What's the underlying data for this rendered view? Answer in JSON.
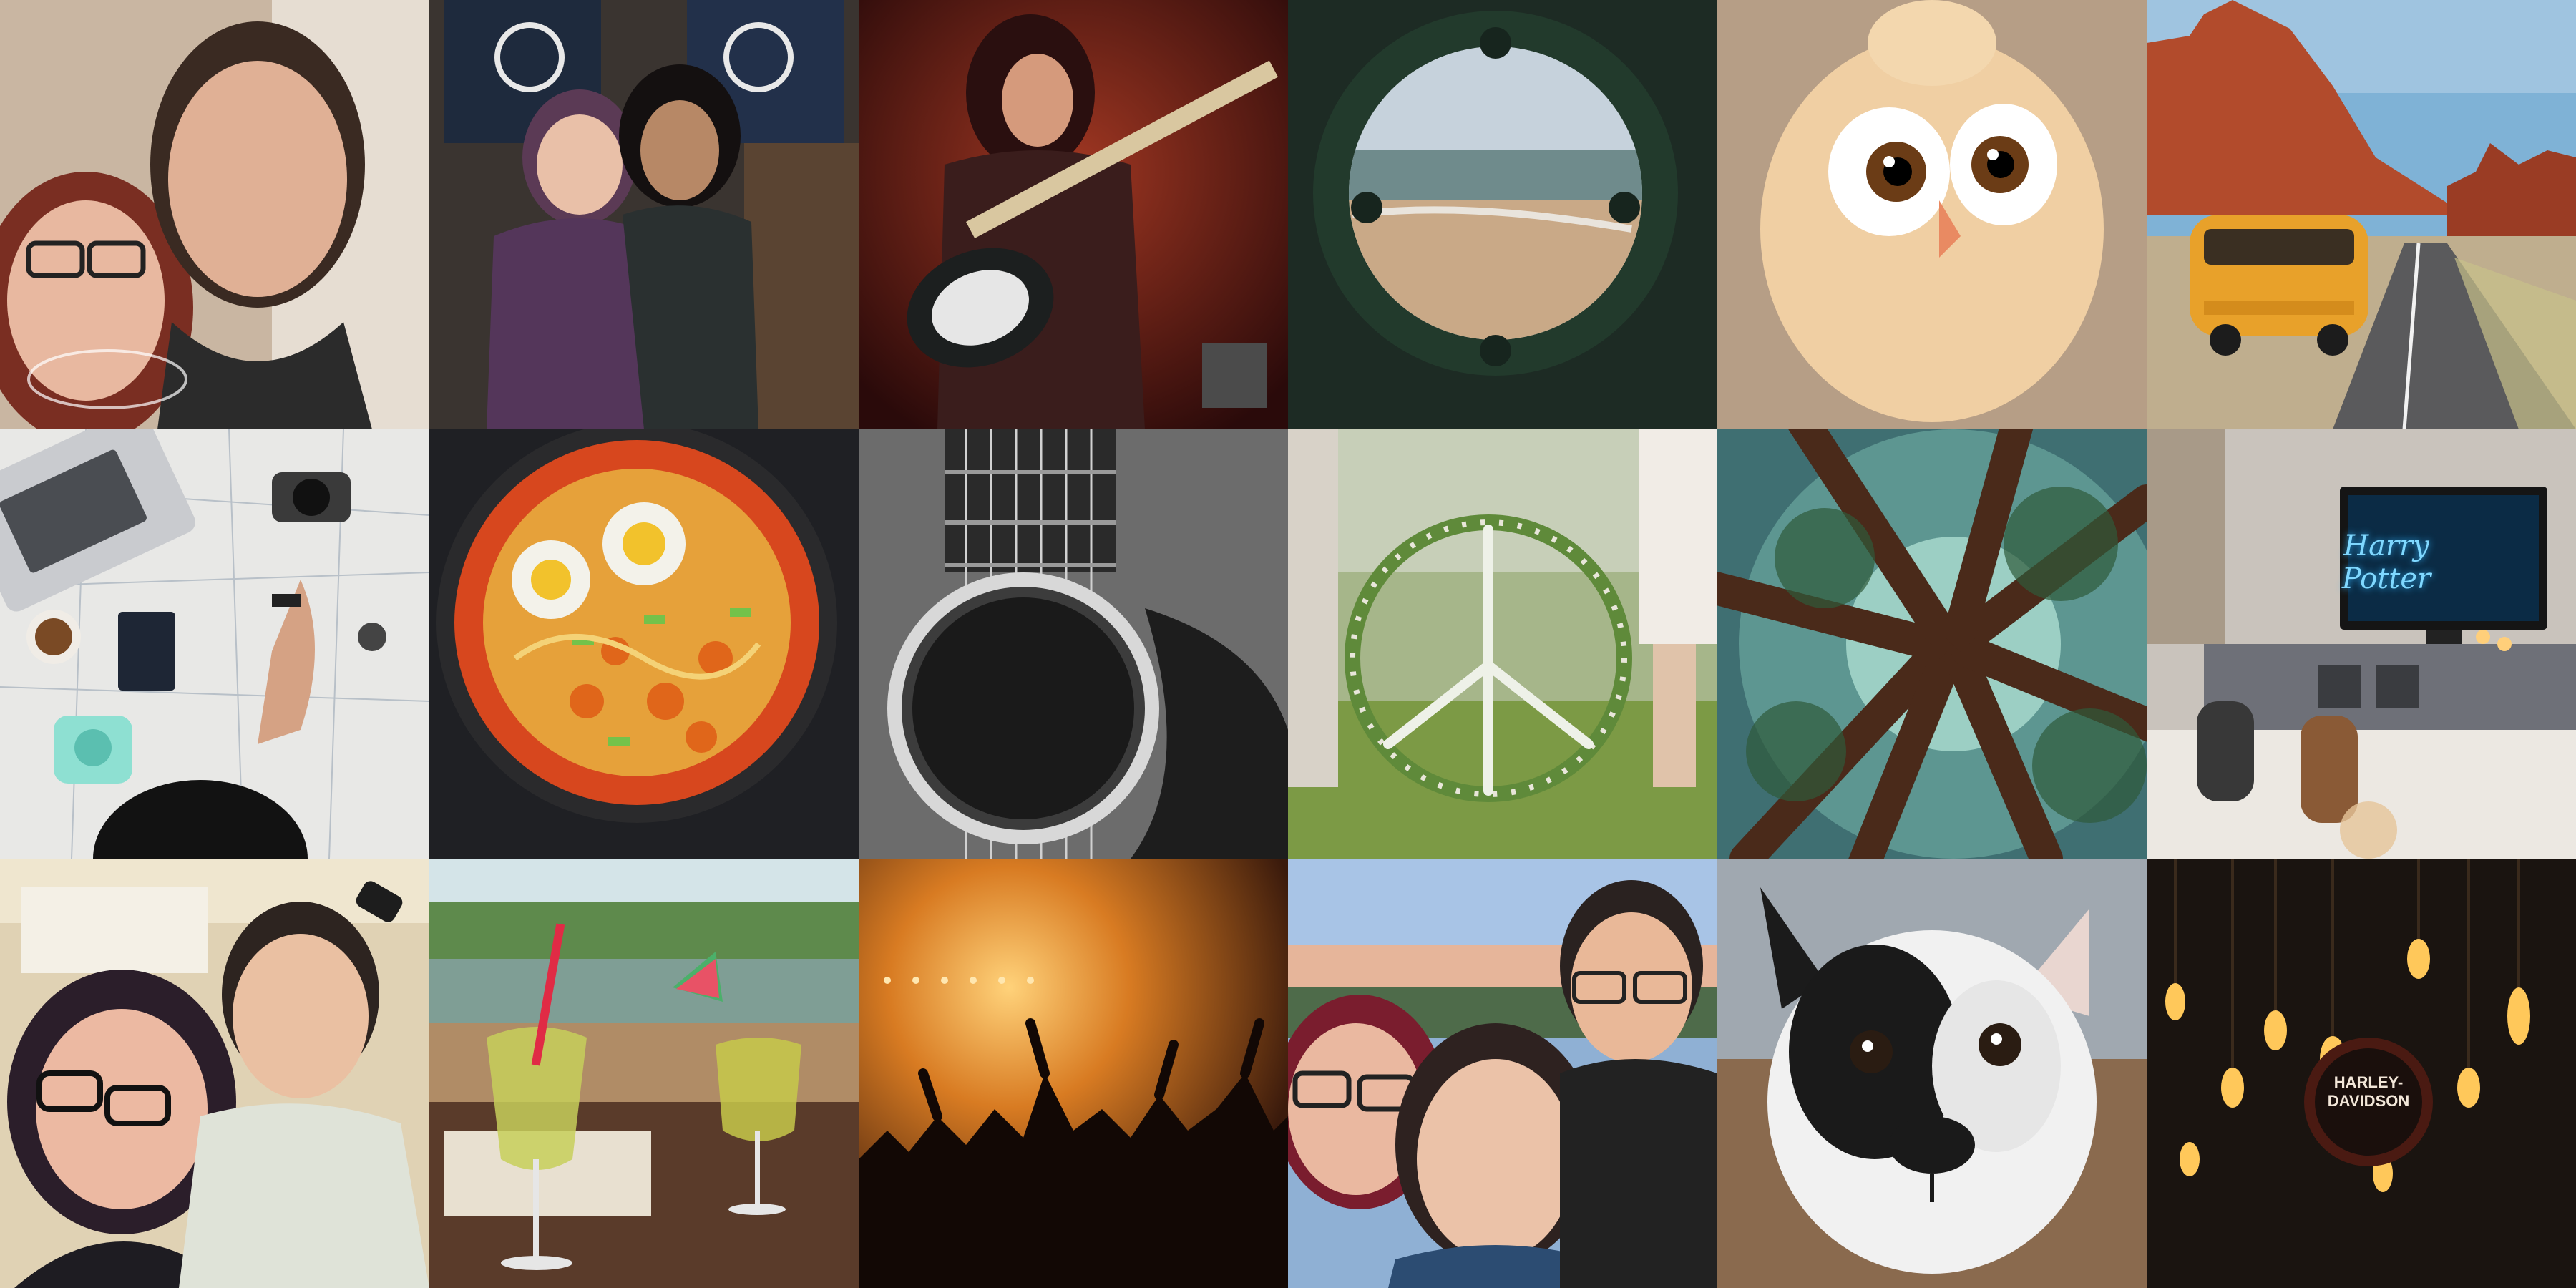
{
  "collage": {
    "columns": 6,
    "rows": 3,
    "tiles": [
      {
        "subject": "couple-selfie"
      },
      {
        "subject": "fans-with-musician"
      },
      {
        "subject": "guitarist-on-stage"
      },
      {
        "subject": "sea-through-porthole"
      },
      {
        "subject": "fluffy-chick"
      },
      {
        "subject": "yellow-van-desert-road"
      },
      {
        "subject": "travel-flatlay-map"
      },
      {
        "subject": "noodle-soup-bowl"
      },
      {
        "subject": "acoustic-guitar-closeup"
      },
      {
        "subject": "flower-peace-wreath"
      },
      {
        "subject": "redwood-canopy"
      },
      {
        "subject": "cozy-tv-evening"
      },
      {
        "subject": "couple-selfie-indoors"
      },
      {
        "subject": "cocktails-on-terrace"
      },
      {
        "subject": "concert-crowd"
      },
      {
        "subject": "group-selfie-sunset"
      },
      {
        "subject": "french-bulldog-puppy"
      },
      {
        "subject": "edison-bulbs"
      }
    ]
  },
  "tv_screen_text": "Harry Potter",
  "sign_text": "HARLEY-DAVIDSON"
}
